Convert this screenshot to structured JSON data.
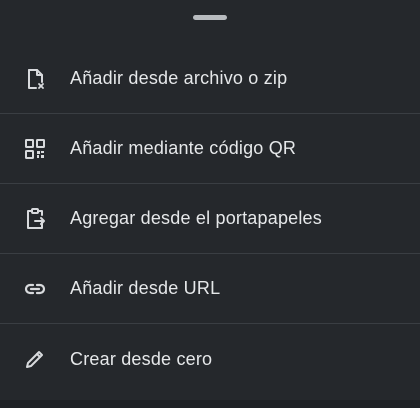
{
  "sheet": {
    "colors": {
      "background": "#25282c",
      "text": "#e6e8ea",
      "divider": "#3a3e43",
      "icon": "#d8dadd"
    },
    "items": [
      {
        "label": "Añadir desde archivo o zip",
        "icon": "file-import-icon"
      },
      {
        "label": "Añadir mediante código QR",
        "icon": "qr-code-icon"
      },
      {
        "label": "Agregar desde el portapapeles",
        "icon": "clipboard-arrow-icon"
      },
      {
        "label": "Añadir desde URL",
        "icon": "link-icon"
      },
      {
        "label": "Crear desde cero",
        "icon": "pencil-icon"
      }
    ]
  }
}
